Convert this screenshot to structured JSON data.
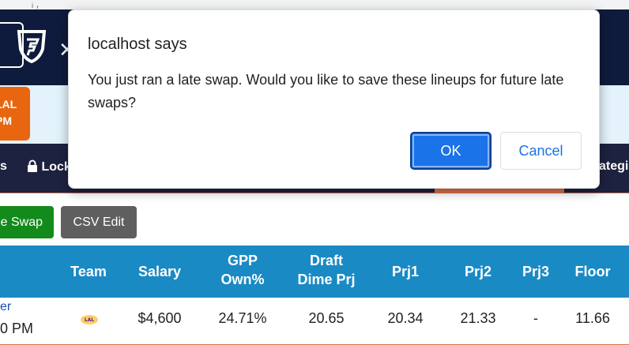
{
  "background": {
    "top_strip_text": "ᵢ ,",
    "live_badge": {
      "line1": "LAL",
      "line2": "PM"
    },
    "tabs": [
      {
        "label": "s"
      },
      {
        "label": "Lock"
      },
      {
        "label": "ategie"
      }
    ],
    "buttons": {
      "late_swap": "e Swap",
      "csv_edit": "CSV Edit"
    },
    "table": {
      "headers": {
        "team": "Team",
        "salary": "Salary",
        "gpp_line1": "GPP",
        "gpp_line2": "Own%",
        "draft_line1": "Draft",
        "draft_line2": "Dime Prj",
        "prj1": "Prj1",
        "prj2": "Prj2",
        "prj3": "Prj3",
        "floor": "Floor"
      },
      "rows": [
        {
          "player": "er",
          "time": "0 PM",
          "team_icon": "lakers-logo",
          "salary": "$4,600",
          "gpp_own": "24.71%",
          "draft_dime_prj": "20.65",
          "prj1": "20.34",
          "prj2": "21.33",
          "prj3": "-",
          "floor": "11.66"
        }
      ]
    }
  },
  "dialog": {
    "title": "localhost says",
    "message": "You just ran a late swap. Would you like to save these lineups for future late swaps?",
    "ok_label": "OK",
    "cancel_label": "Cancel"
  },
  "colors": {
    "navbar": "#0f1b3d",
    "accent_orange": "#e8660f",
    "table_header": "#1a8ac4",
    "late_swap_button": "#138a1c",
    "csv_button": "#5f5f5f",
    "dialog_primary": "#1a73e8"
  }
}
